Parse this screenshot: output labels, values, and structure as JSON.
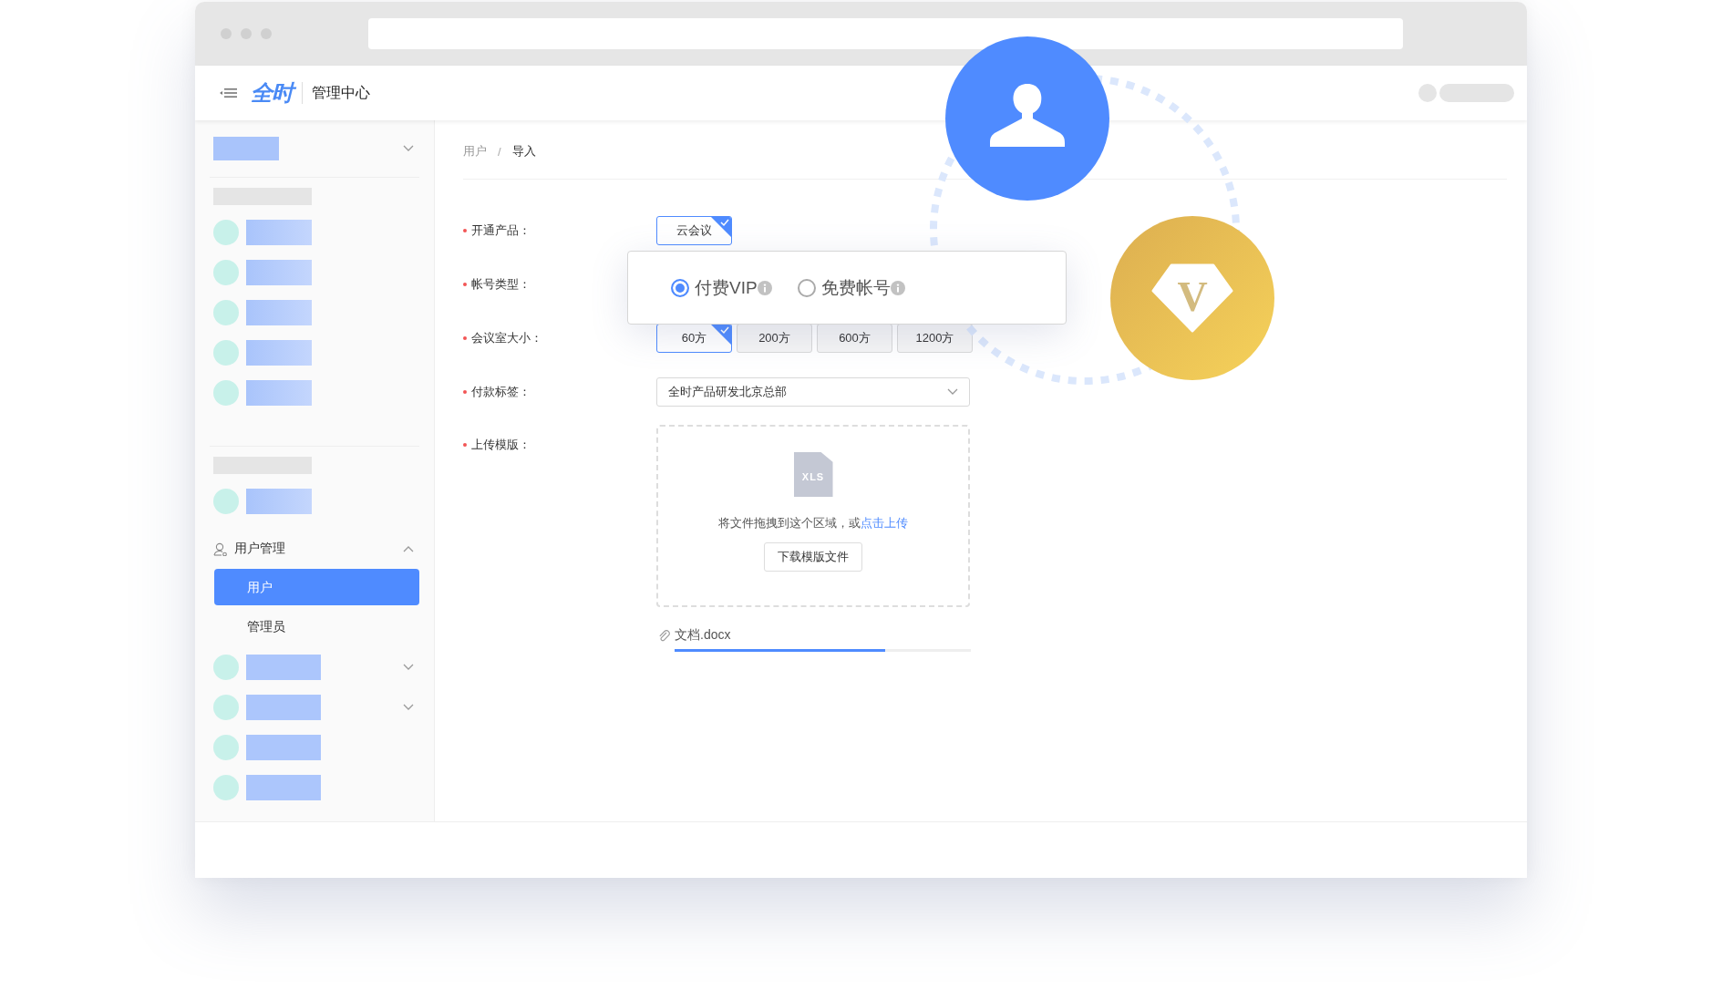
{
  "header": {
    "logo": "全时",
    "title": "管理中心"
  },
  "sidebar": {
    "items": [
      {
        "kind": "title",
        "expanded": false
      },
      {
        "kind": "divider"
      },
      {
        "kind": "caption"
      },
      {
        "kind": "entry"
      },
      {
        "kind": "entry"
      },
      {
        "kind": "entry"
      },
      {
        "kind": "entry"
      },
      {
        "kind": "entry"
      },
      {
        "kind": "divider"
      },
      {
        "kind": "caption"
      },
      {
        "kind": "entry"
      },
      {
        "kind": "group",
        "label": "用户管理",
        "expanded": true,
        "children": [
          {
            "label": "用户",
            "selected": true
          },
          {
            "label": "管理员",
            "selected": false
          }
        ]
      },
      {
        "kind": "entry",
        "expanded": false
      },
      {
        "kind": "entry",
        "expanded": false
      },
      {
        "kind": "entry"
      },
      {
        "kind": "entry"
      }
    ]
  },
  "breadcrumb": {
    "items": [
      "用户",
      "导入"
    ],
    "separator": "/"
  },
  "form": {
    "fields": [
      {
        "label": "开通产品：",
        "required": true,
        "kind": "choice",
        "options": [
          {
            "label": "云会议",
            "selected": true
          }
        ]
      },
      {
        "label": "帐号类型：",
        "required": true,
        "kind": "popup",
        "options": [
          {
            "label": "付费VIP",
            "selected": true
          },
          {
            "label": "免费帐号",
            "selected": false
          }
        ]
      },
      {
        "label": "会议室大小：",
        "required": true,
        "kind": "choice",
        "options": [
          {
            "label": "60方",
            "selected": true
          },
          {
            "label": "200方",
            "selected": false
          },
          {
            "label": "600方",
            "selected": false
          },
          {
            "label": "1200方",
            "selected": false
          }
        ]
      },
      {
        "label": "付款标签：",
        "required": true,
        "kind": "select",
        "value": "全时产品研发北京总部"
      },
      {
        "label": "上传模版：",
        "required": true,
        "kind": "upload",
        "icon_text": "XLS",
        "hint": "将文件拖拽到这个区域，或",
        "link": "点击上传",
        "button": "下载模版文件",
        "file": {
          "name": "文档.docx",
          "level": 0.71
        }
      }
    ]
  },
  "badges": [
    {
      "kind": "user"
    },
    {
      "kind": "vip",
      "letter": "V"
    }
  ]
}
